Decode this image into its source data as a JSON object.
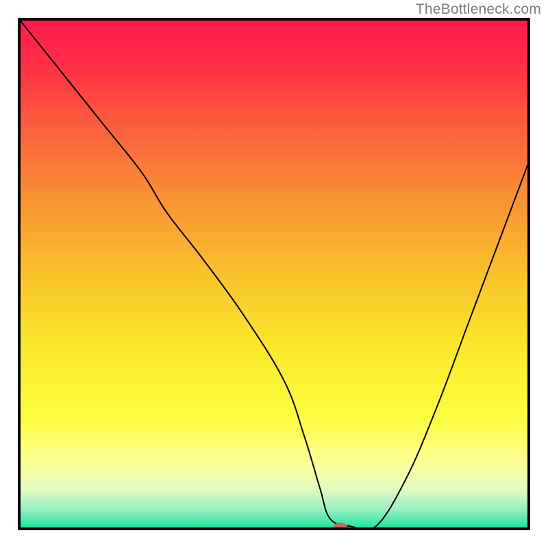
{
  "watermark": "TheBottleneck.com",
  "chart_data": {
    "type": "line",
    "title": "",
    "xlabel": "",
    "ylabel": "",
    "xlim": [
      0,
      100
    ],
    "ylim": [
      0,
      100
    ],
    "legend": null,
    "grid": false,
    "background_gradient": {
      "stops": [
        {
          "offset": 0.0,
          "color": "#ff1a4b"
        },
        {
          "offset": 0.08,
          "color": "#ff2b47"
        },
        {
          "offset": 0.2,
          "color": "#fb5a3e"
        },
        {
          "offset": 0.35,
          "color": "#f99134"
        },
        {
          "offset": 0.5,
          "color": "#f9c22c"
        },
        {
          "offset": 0.65,
          "color": "#faea2b"
        },
        {
          "offset": 0.78,
          "color": "#fdfc3f"
        },
        {
          "offset": 0.86,
          "color": "#feff8d"
        },
        {
          "offset": 0.92,
          "color": "#e7fbc0"
        },
        {
          "offset": 0.96,
          "color": "#9cf0c2"
        },
        {
          "offset": 1.0,
          "color": "#18e49a"
        }
      ]
    },
    "series": [
      {
        "name": "bottleneck-curve",
        "color": "#000000",
        "linewidth": 2,
        "x": [
          0,
          8,
          16,
          24,
          29,
          36,
          44,
          52,
          56,
          59,
          61,
          65,
          70,
          76,
          82,
          88,
          94,
          100
        ],
        "y": [
          100,
          90,
          80,
          70,
          62,
          53,
          42,
          29,
          18,
          8,
          2,
          0.5,
          0.5,
          10,
          24,
          40,
          56,
          72
        ]
      }
    ],
    "marker": {
      "name": "optimal-point",
      "x": 63,
      "y": 0.4,
      "color": "#d26065",
      "rx": 10,
      "ry": 6
    },
    "frame": {
      "color": "#000000",
      "width": 4
    }
  }
}
